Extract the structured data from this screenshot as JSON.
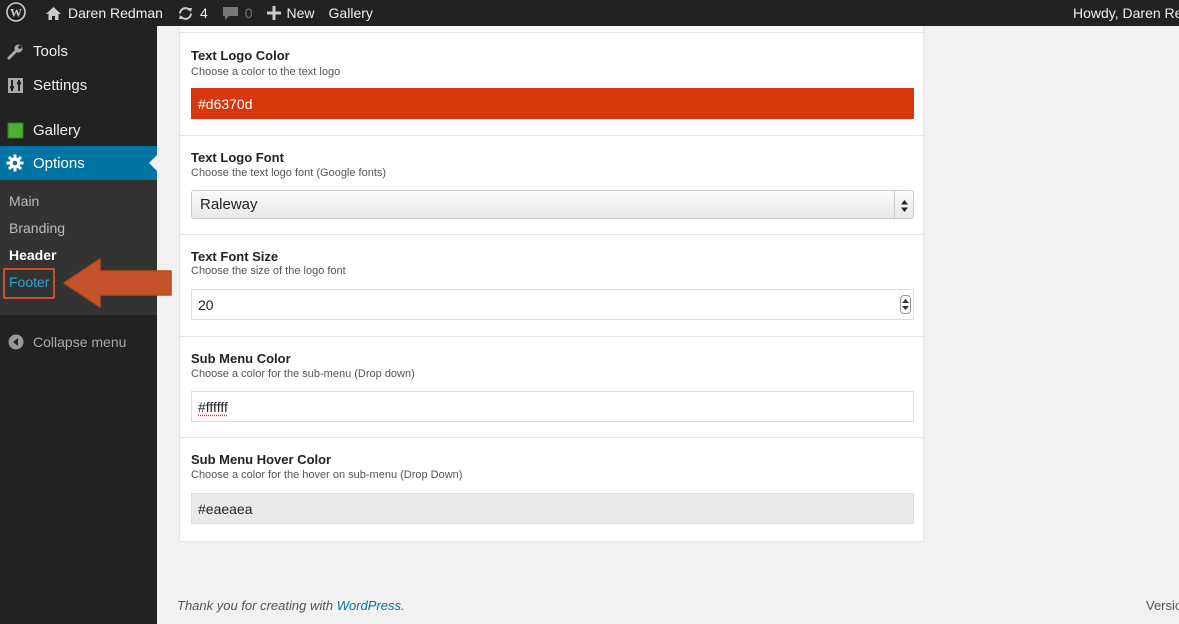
{
  "adminbar": {
    "site_name": "Daren Redman",
    "updates_count": "4",
    "comments_count": "0",
    "new_label": "New",
    "gallery_label": "Gallery",
    "howdy": "Howdy, Daren Red"
  },
  "sidebar": {
    "items": [
      {
        "label": "Tools",
        "icon": "wrench-icon"
      },
      {
        "label": "Settings",
        "icon": "sliders-icon"
      },
      {
        "label": "Gallery",
        "icon": "gallery-icon"
      },
      {
        "label": "Options",
        "icon": "gear-icon"
      }
    ],
    "submenu": [
      {
        "label": "Main"
      },
      {
        "label": "Branding"
      },
      {
        "label": "Header"
      },
      {
        "label": "Footer"
      }
    ],
    "collapse_label": "Collapse menu"
  },
  "options": {
    "text_logo_color": {
      "title": "Text Logo Color",
      "desc": "Choose a color to the text logo",
      "value": "#d6370d"
    },
    "text_logo_font": {
      "title": "Text Logo Font",
      "desc": "Choose the text logo font (Google fonts)",
      "value": "Raleway"
    },
    "text_font_size": {
      "title": "Text Font Size",
      "desc": "Choose the size of the logo font",
      "value": "20"
    },
    "sub_menu_color": {
      "title": "Sub Menu Color",
      "desc": "Choose a color for the sub-menu (Drop down)",
      "value": "#ffffff"
    },
    "sub_menu_hover_color": {
      "title": "Sub Menu Hover Color",
      "desc": "Choose a color for the hover on sub-menu (Drop Down)",
      "value": "#eaeaea"
    }
  },
  "footer": {
    "thanks_prefix": "Thank you for creating with ",
    "thanks_link": "WordPress",
    "thanks_suffix": ".",
    "version": "Versio"
  },
  "colors": {
    "admin_bg": "#222222",
    "active_blue": "#0074a2",
    "link_blue": "#2ea2cc",
    "annotation_orange": "#c5522a",
    "logo_color_swatch": "#d6370d",
    "hover_color_swatch": "#eaeaea"
  }
}
